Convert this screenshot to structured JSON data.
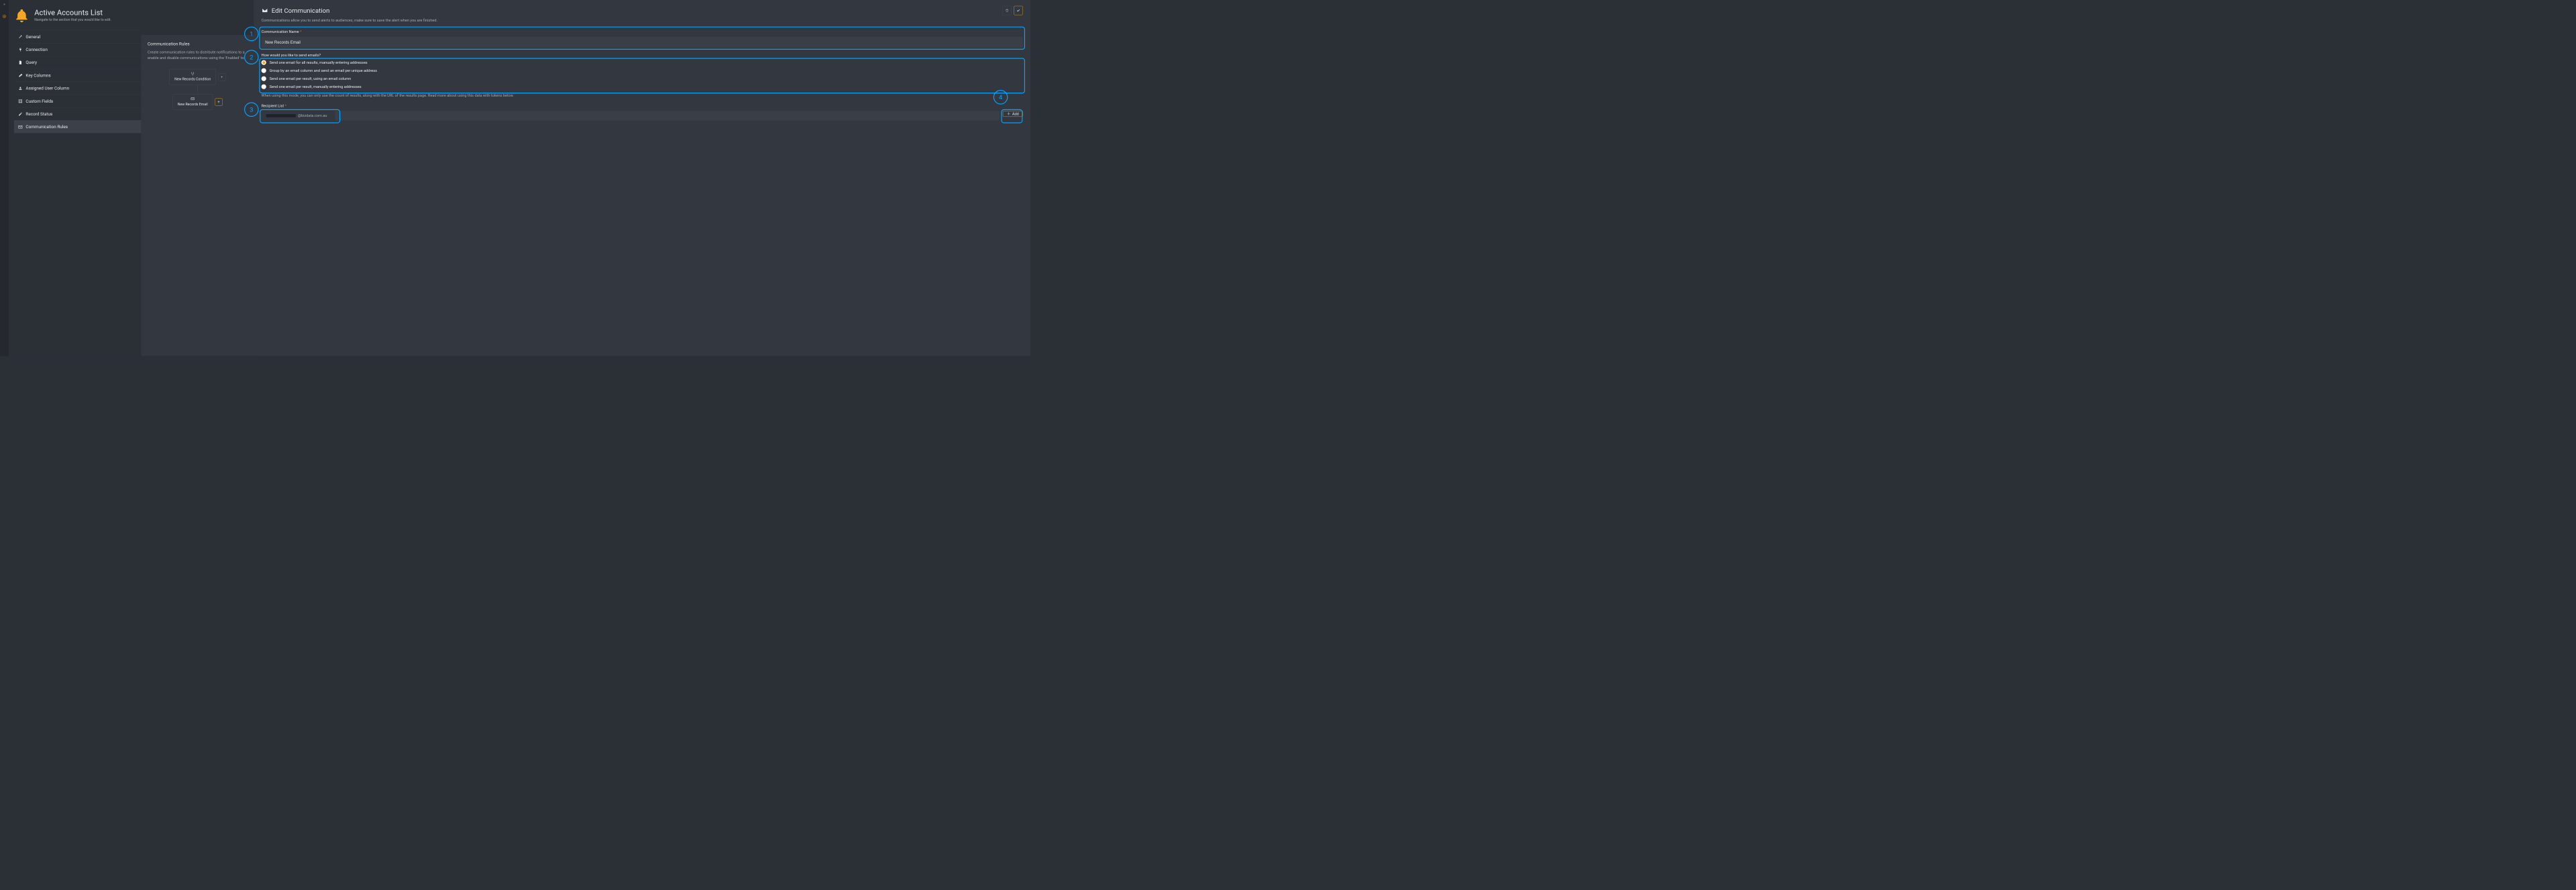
{
  "header": {
    "title": "Active Accounts List",
    "subtitle": "Navigate to the section that you would like to edit."
  },
  "sidebar": {
    "items": [
      {
        "icon": "wrench-icon",
        "label": "General"
      },
      {
        "icon": "plug-icon",
        "label": "Connection"
      },
      {
        "icon": "file-icon",
        "label": "Query"
      },
      {
        "icon": "key-icon",
        "label": "Key Columns"
      },
      {
        "icon": "user-icon",
        "label": "Assigned User Column"
      },
      {
        "icon": "columns-icon",
        "label": "Custom Fields"
      },
      {
        "icon": "edit-icon",
        "label": "Record Status"
      },
      {
        "icon": "envelope-icon",
        "label": "Communication Rules"
      }
    ],
    "active_index": 7
  },
  "rules_canvas": {
    "title": "Communication Rules",
    "description": "Create communication rules to distribute notifications to a enable and disable communications using the 'Enabled' to",
    "condition_node": "New Records Condition",
    "email_node": "New Records Email"
  },
  "edit_panel": {
    "heading": "Edit Communication",
    "description": "Communications allow you to send alerts to audiences, make sure to save the alert when you are finished.",
    "name_field": {
      "label": "Communication Name",
      "required_mark": "*",
      "value": "New Records Email"
    },
    "send_mode": {
      "question": "How would you like to send emails?",
      "options": [
        "Send one email for all results, manually entering addresses",
        "Group by an email column and send an email per unique address",
        "Send one email per result, using an email column",
        "Send one email per result, manually entering addresses"
      ],
      "selected_index": 0,
      "hint": "When using this mode, you can only use the count of results, along with the URL of the results page. Read more about using this data with tokens below."
    },
    "recipients": {
      "label": "Recipient List",
      "required_mark": "*",
      "chip_domain": "@bizdata.com.au",
      "add_label": "Add"
    }
  },
  "annotations": {
    "circles": [
      "1",
      "2",
      "3",
      "4"
    ]
  }
}
